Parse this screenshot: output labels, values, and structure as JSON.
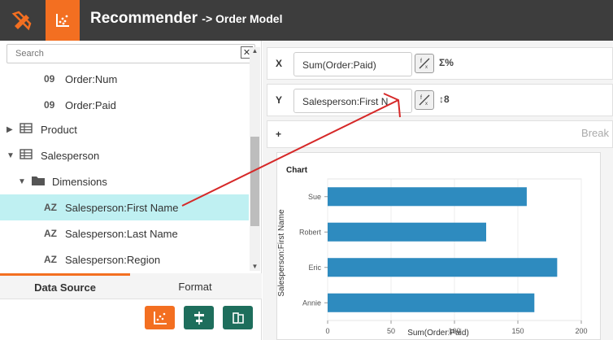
{
  "header": {
    "title": "Recommender",
    "subtitle": "-> Order Model",
    "colors": {
      "bar": "#3d3d3d",
      "accent": "#f36f21"
    }
  },
  "sidebar": {
    "search_placeholder": "Search",
    "clear_icon": "close-icon",
    "items": [
      {
        "type_tag": "09",
        "label": "Order:Num"
      },
      {
        "type_tag": "09",
        "label": "Order:Paid"
      },
      {
        "caret": "▶",
        "icon": "table-icon",
        "label": "Product"
      },
      {
        "caret": "▼",
        "icon": "table-icon",
        "label": "Salesperson"
      },
      {
        "caret": "▼",
        "icon": "folder-icon",
        "label": "Dimensions"
      },
      {
        "type_tag": "AZ",
        "label": "Salesperson:First Name",
        "selected": true
      },
      {
        "type_tag": "AZ",
        "label": "Salesperson:Last Name"
      },
      {
        "type_tag": "AZ",
        "label": "Salesperson:Region"
      }
    ],
    "tabs": [
      {
        "label": "Data Source",
        "active": true
      },
      {
        "label": "Format",
        "active": false
      }
    ],
    "tool_buttons": [
      {
        "icon": "chart-icon",
        "color": "#f36f21"
      },
      {
        "icon": "align-icon",
        "color": "#1e6e5c"
      },
      {
        "icon": "swap-icon",
        "color": "#1e6e5c"
      }
    ]
  },
  "axes": {
    "x": {
      "label": "X",
      "field": "Sum(Order:Paid)",
      "extra": "Σ%"
    },
    "y": {
      "label": "Y",
      "field": "Salesperson:First N",
      "extra": "↕8"
    },
    "break": {
      "label": "+",
      "text": "Break"
    }
  },
  "chart_data": {
    "type": "bar",
    "orientation": "horizontal",
    "title": "Chart",
    "categories": [
      "Sue",
      "Robert",
      "Eric",
      "Annie"
    ],
    "values": [
      157,
      125,
      181,
      163
    ],
    "xlabel": "Sum(Order:Paid)",
    "ylabel": "Salesperson:First Name",
    "xlim": [
      0,
      200
    ],
    "xticks": [
      "0",
      "50",
      "100",
      "150",
      "200"
    ],
    "grid": true,
    "bar_color": "#2e8bbf"
  }
}
